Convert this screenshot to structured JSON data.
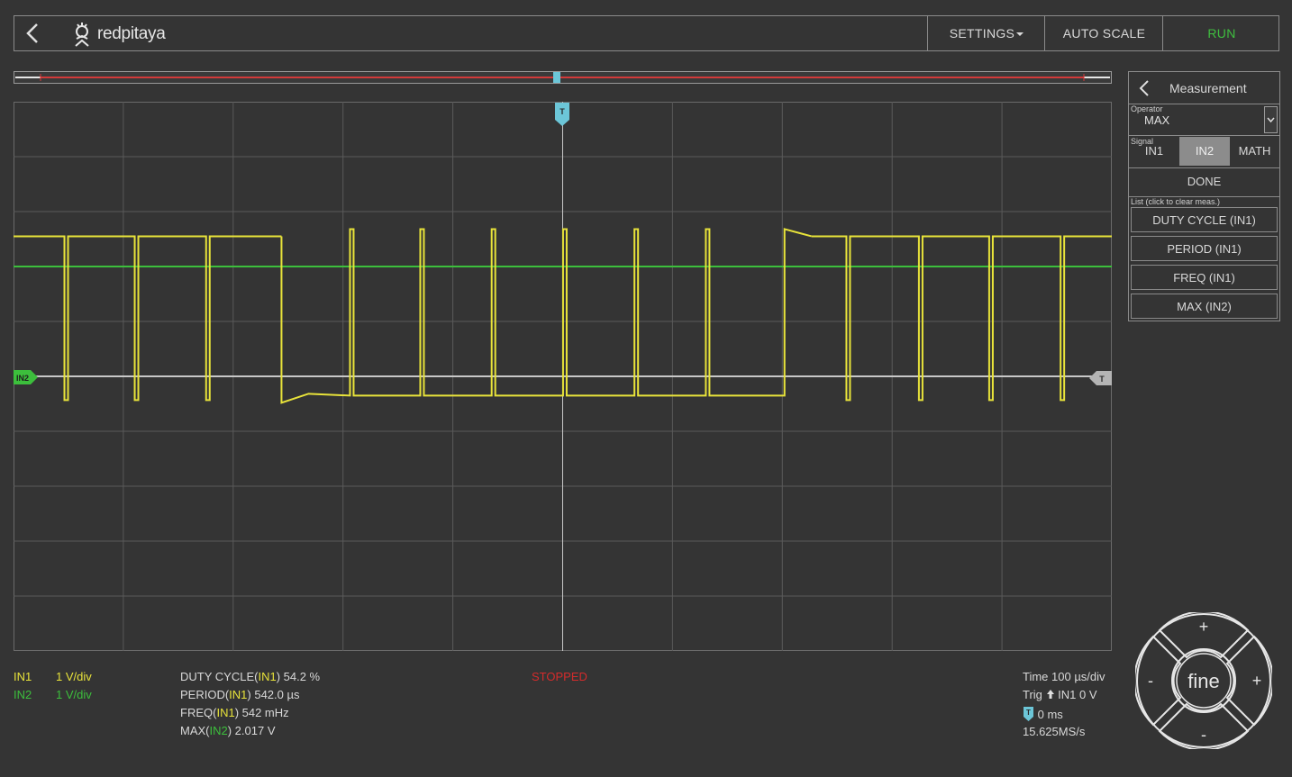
{
  "header": {
    "logo_text": "redpitaya",
    "settings_label": "SETTINGS",
    "autoscale_label": "AUTO SCALE",
    "run_label": "RUN"
  },
  "colors": {
    "ch1": "#e8e33a",
    "ch2": "#3cbf3c",
    "trigger": "#6cc6d8",
    "stopped": "#d42b2b",
    "grid": "#5a5a5a"
  },
  "plot": {
    "trigger_top_marker": "T",
    "in2_marker": "IN2",
    "trigger_level_marker": "T"
  },
  "chart_data": {
    "type": "line",
    "title": "",
    "xlabel": "",
    "ylabel": "",
    "x_divisions": 10,
    "y_divisions": 10,
    "grid": true,
    "series": [
      {
        "name": "IN1",
        "pulses": [
          {
            "x": 0.48,
            "state": "low_pulse"
          },
          {
            "x": 1.12,
            "state": "low_pulse"
          },
          {
            "x": 1.77,
            "state": "low_pulse"
          },
          {
            "x": 3.08,
            "state": "high_pulse"
          },
          {
            "x": 3.72,
            "state": "high_pulse"
          },
          {
            "x": 4.37,
            "state": "high_pulse"
          },
          {
            "x": 5.02,
            "state": "high_pulse"
          },
          {
            "x": 5.67,
            "state": "high_pulse"
          },
          {
            "x": 6.32,
            "state": "high_pulse"
          },
          {
            "x": 7.6,
            "state": "low_pulse"
          },
          {
            "x": 8.26,
            "state": "low_pulse"
          },
          {
            "x": 8.9,
            "state": "low_pulse"
          },
          {
            "x": 9.55,
            "state": "low_pulse"
          }
        ],
        "high_level_div": 2.45,
        "low_level_div": 5.35,
        "low_segment_x": [
          2.44,
          7.02
        ]
      },
      {
        "name": "IN2",
        "level_div": 3.0
      }
    ]
  },
  "sidebar": {
    "title": "Measurement",
    "operator_label": "Operator",
    "operator_value": "MAX",
    "signal_label": "Signal",
    "signals": [
      "IN1",
      "IN2",
      "MATH"
    ],
    "done_label": "DONE",
    "list_label": "List (click to clear meas.)",
    "measurements": [
      "DUTY CYCLE (IN1)",
      "PERIOD (IN1)",
      "FREQ (IN1)",
      "MAX (IN2)"
    ]
  },
  "bottom": {
    "ch1_name": "IN1",
    "ch1_scale": "1 V/div",
    "ch2_name": "IN2",
    "ch2_scale": "1 V/div",
    "m1_prefix": "DUTY CYCLE(",
    "m1_ch": "IN1",
    "m1_suffix": ") 54.2 %",
    "m2_prefix": "PERIOD(",
    "m2_ch": "IN1",
    "m2_suffix": ") 542.0 µs",
    "m3_prefix": "FREQ(",
    "m3_ch": "IN1",
    "m3_suffix": ") 542 mHz",
    "m4_prefix": "MAX(",
    "m4_ch": "IN2",
    "m4_suffix": ") 2.017 V",
    "status": "STOPPED",
    "time": "Time 100 µs/div",
    "trig_prefix": "Trig",
    "trig_suffix": "IN1 0 V",
    "trig_marker": "T",
    "trig_delay": "0 ms",
    "sample_rate": "15.625MS/s"
  },
  "dial": {
    "center": "fine",
    "top": "+",
    "bottom": "-",
    "left": "-",
    "right": "+"
  }
}
